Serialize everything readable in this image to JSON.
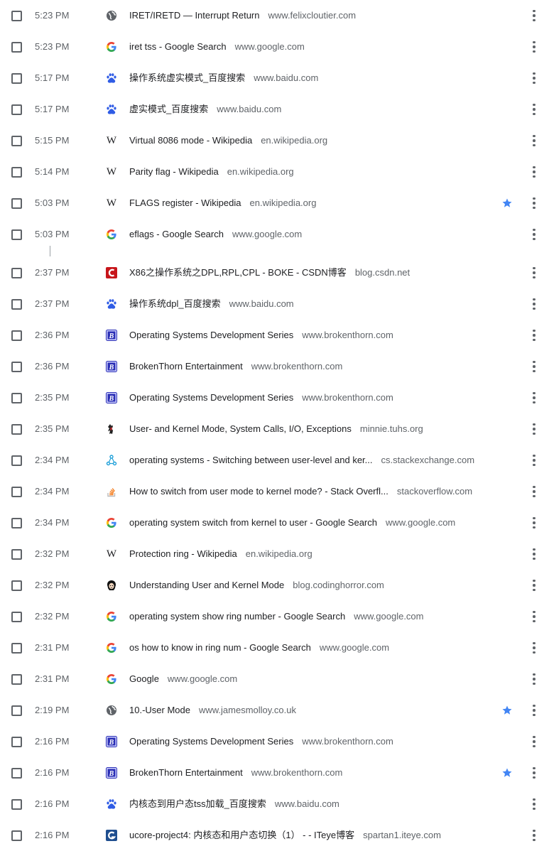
{
  "history": {
    "items": [
      {
        "time": "5:23 PM",
        "title": "IRET/IRETD — Interrupt Return",
        "domain": "www.felixcloutier.com",
        "icon": "globe-icon",
        "starred": false
      },
      {
        "time": "5:23 PM",
        "title": "iret tss - Google Search",
        "domain": "www.google.com",
        "icon": "google-icon",
        "starred": false
      },
      {
        "time": "5:17 PM",
        "title": "操作系统虚实模式_百度搜索",
        "domain": "www.baidu.com",
        "icon": "baidu-icon",
        "starred": false
      },
      {
        "time": "5:17 PM",
        "title": "虚实模式_百度搜索",
        "domain": "www.baidu.com",
        "icon": "baidu-icon",
        "starred": false
      },
      {
        "time": "5:15 PM",
        "title": "Virtual 8086 mode - Wikipedia",
        "domain": "en.wikipedia.org",
        "icon": "wikipedia-icon",
        "starred": false
      },
      {
        "time": "5:14 PM",
        "title": "Parity flag - Wikipedia",
        "domain": "en.wikipedia.org",
        "icon": "wikipedia-icon",
        "starred": false
      },
      {
        "time": "5:03 PM",
        "title": "FLAGS register - Wikipedia",
        "domain": "en.wikipedia.org",
        "icon": "wikipedia-icon",
        "starred": true
      },
      {
        "time": "5:03 PM",
        "title": "eflags - Google Search",
        "domain": "www.google.com",
        "icon": "google-icon",
        "starred": false
      },
      {
        "time": "2:37 PM",
        "title": "X86之操作系统之DPL,RPL,CPL - BOKE - CSDN博客",
        "domain": "blog.csdn.net",
        "icon": "csdn-icon",
        "starred": false
      },
      {
        "time": "2:37 PM",
        "title": "操作系统dpl_百度搜索",
        "domain": "www.baidu.com",
        "icon": "baidu-icon",
        "starred": false
      },
      {
        "time": "2:36 PM",
        "title": "Operating Systems Development Series",
        "domain": "www.brokenthorn.com",
        "icon": "brokenthorn-icon",
        "starred": false
      },
      {
        "time": "2:36 PM",
        "title": "BrokenThorn Entertainment",
        "domain": "www.brokenthorn.com",
        "icon": "brokenthorn-icon",
        "starred": false
      },
      {
        "time": "2:35 PM",
        "title": "Operating Systems Development Series",
        "domain": "www.brokenthorn.com",
        "icon": "brokenthorn-icon",
        "starred": false
      },
      {
        "time": "2:35 PM",
        "title": "User- and Kernel Mode, System Calls, I/O, Exceptions",
        "domain": "minnie.tuhs.org",
        "icon": "tuhs-icon",
        "starred": false
      },
      {
        "time": "2:34 PM",
        "title": "operating systems - Switching between user-level and ker...",
        "domain": "cs.stackexchange.com",
        "icon": "stackexchange-icon",
        "starred": false
      },
      {
        "time": "2:34 PM",
        "title": "How to switch from user mode to kernel mode? - Stack Overfl...",
        "domain": "stackoverflow.com",
        "icon": "stackoverflow-icon",
        "starred": false
      },
      {
        "time": "2:34 PM",
        "title": "operating system switch from kernel to user - Google Search",
        "domain": "www.google.com",
        "icon": "google-icon",
        "starred": false
      },
      {
        "time": "2:32 PM",
        "title": "Protection ring - Wikipedia",
        "domain": "en.wikipedia.org",
        "icon": "wikipedia-icon",
        "starred": false
      },
      {
        "time": "2:32 PM",
        "title": "Understanding User and Kernel Mode",
        "domain": "blog.codinghorror.com",
        "icon": "codinghorror-icon",
        "starred": false
      },
      {
        "time": "2:32 PM",
        "title": "operating system show ring number - Google Search",
        "domain": "www.google.com",
        "icon": "google-icon",
        "starred": false
      },
      {
        "time": "2:31 PM",
        "title": "os how to know in ring num - Google Search",
        "domain": "www.google.com",
        "icon": "google-icon",
        "starred": false
      },
      {
        "time": "2:31 PM",
        "title": "Google",
        "domain": "www.google.com",
        "icon": "google-icon",
        "starred": false
      },
      {
        "time": "2:19 PM",
        "title": "10.-User Mode",
        "domain": "www.jamesmolloy.co.uk",
        "icon": "globe-icon",
        "starred": true
      },
      {
        "time": "2:16 PM",
        "title": "Operating Systems Development Series",
        "domain": "www.brokenthorn.com",
        "icon": "brokenthorn-icon",
        "starred": false
      },
      {
        "time": "2:16 PM",
        "title": "BrokenThorn Entertainment",
        "domain": "www.brokenthorn.com",
        "icon": "brokenthorn-icon",
        "starred": true
      },
      {
        "time": "2:16 PM",
        "title": "内核态到用户态tss加载_百度搜索",
        "domain": "www.baidu.com",
        "icon": "baidu-icon",
        "starred": false
      },
      {
        "time": "2:16 PM",
        "title": "ucore-project4: 内核态和用户态切换（1） - - ITeye博客",
        "domain": "spartan1.iteye.com",
        "icon": "iteye-icon",
        "starred": false
      }
    ]
  },
  "colors": {
    "star": "#4285f4",
    "csdn": "#c7161b",
    "baidu": "#2f5ce5",
    "brokenthorn": "#2b2fb5",
    "stackexchange": "#1e9fd8",
    "stackoverflow": "#f48024"
  }
}
